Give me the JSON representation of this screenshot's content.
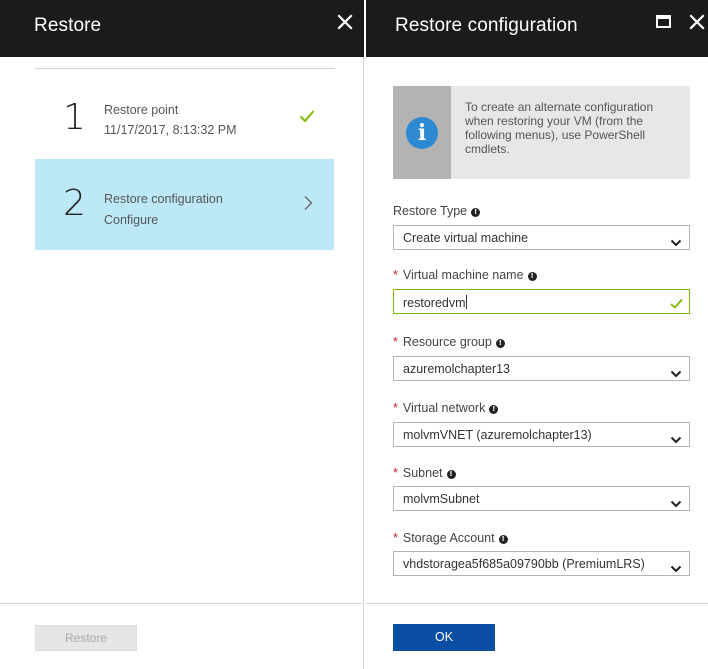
{
  "restore_blade": {
    "title": "Restore",
    "steps": [
      {
        "number": "1",
        "title": "Restore point",
        "subtitle": "11/17/2017, 8:13:32 PM",
        "status": "complete"
      },
      {
        "number": "2",
        "title": "Restore configuration",
        "subtitle": "Configure",
        "status": "selected"
      }
    ],
    "restore_button_label": "Restore"
  },
  "config_blade": {
    "title": "Restore configuration",
    "info_text": "To create an alternate configuration when restoring your VM (from the following menus), use PowerShell cmdlets.",
    "fields": {
      "restore_type": {
        "label": "Restore Type",
        "required": false,
        "value": "Create virtual machine"
      },
      "vm_name": {
        "label": "Virtual machine name",
        "required": true,
        "value": "restoredvm"
      },
      "resource_group": {
        "label": "Resource group",
        "required": true,
        "value": "azuremolchapter13"
      },
      "virtual_network": {
        "label": "Virtual network",
        "required": true,
        "value": "molvmVNET (azuremolchapter13)"
      },
      "subnet": {
        "label": "Subnet",
        "required": true,
        "value": "molvmSubnet"
      },
      "storage_account": {
        "label": "Storage Account",
        "required": true,
        "value": "vhdstoragea5f685a09790bb (PremiumLRS)"
      }
    },
    "required_marker": "*",
    "ok_button_label": "OK"
  },
  "colors": {
    "header_bg": "#1b1b1b",
    "selected_step_bg": "#bde8f8",
    "check_green": "#7fb800",
    "required_red": "#c8202e",
    "info_blue": "#2d8ad2",
    "ok_button_bg": "#0a4fa4"
  },
  "icons": {
    "close": "close-icon",
    "maximize": "maximize-icon",
    "check": "checkmark-icon",
    "chevron_right": "chevron-right-icon",
    "chevron_down": "chevron-down-icon",
    "info": "info-icon"
  }
}
